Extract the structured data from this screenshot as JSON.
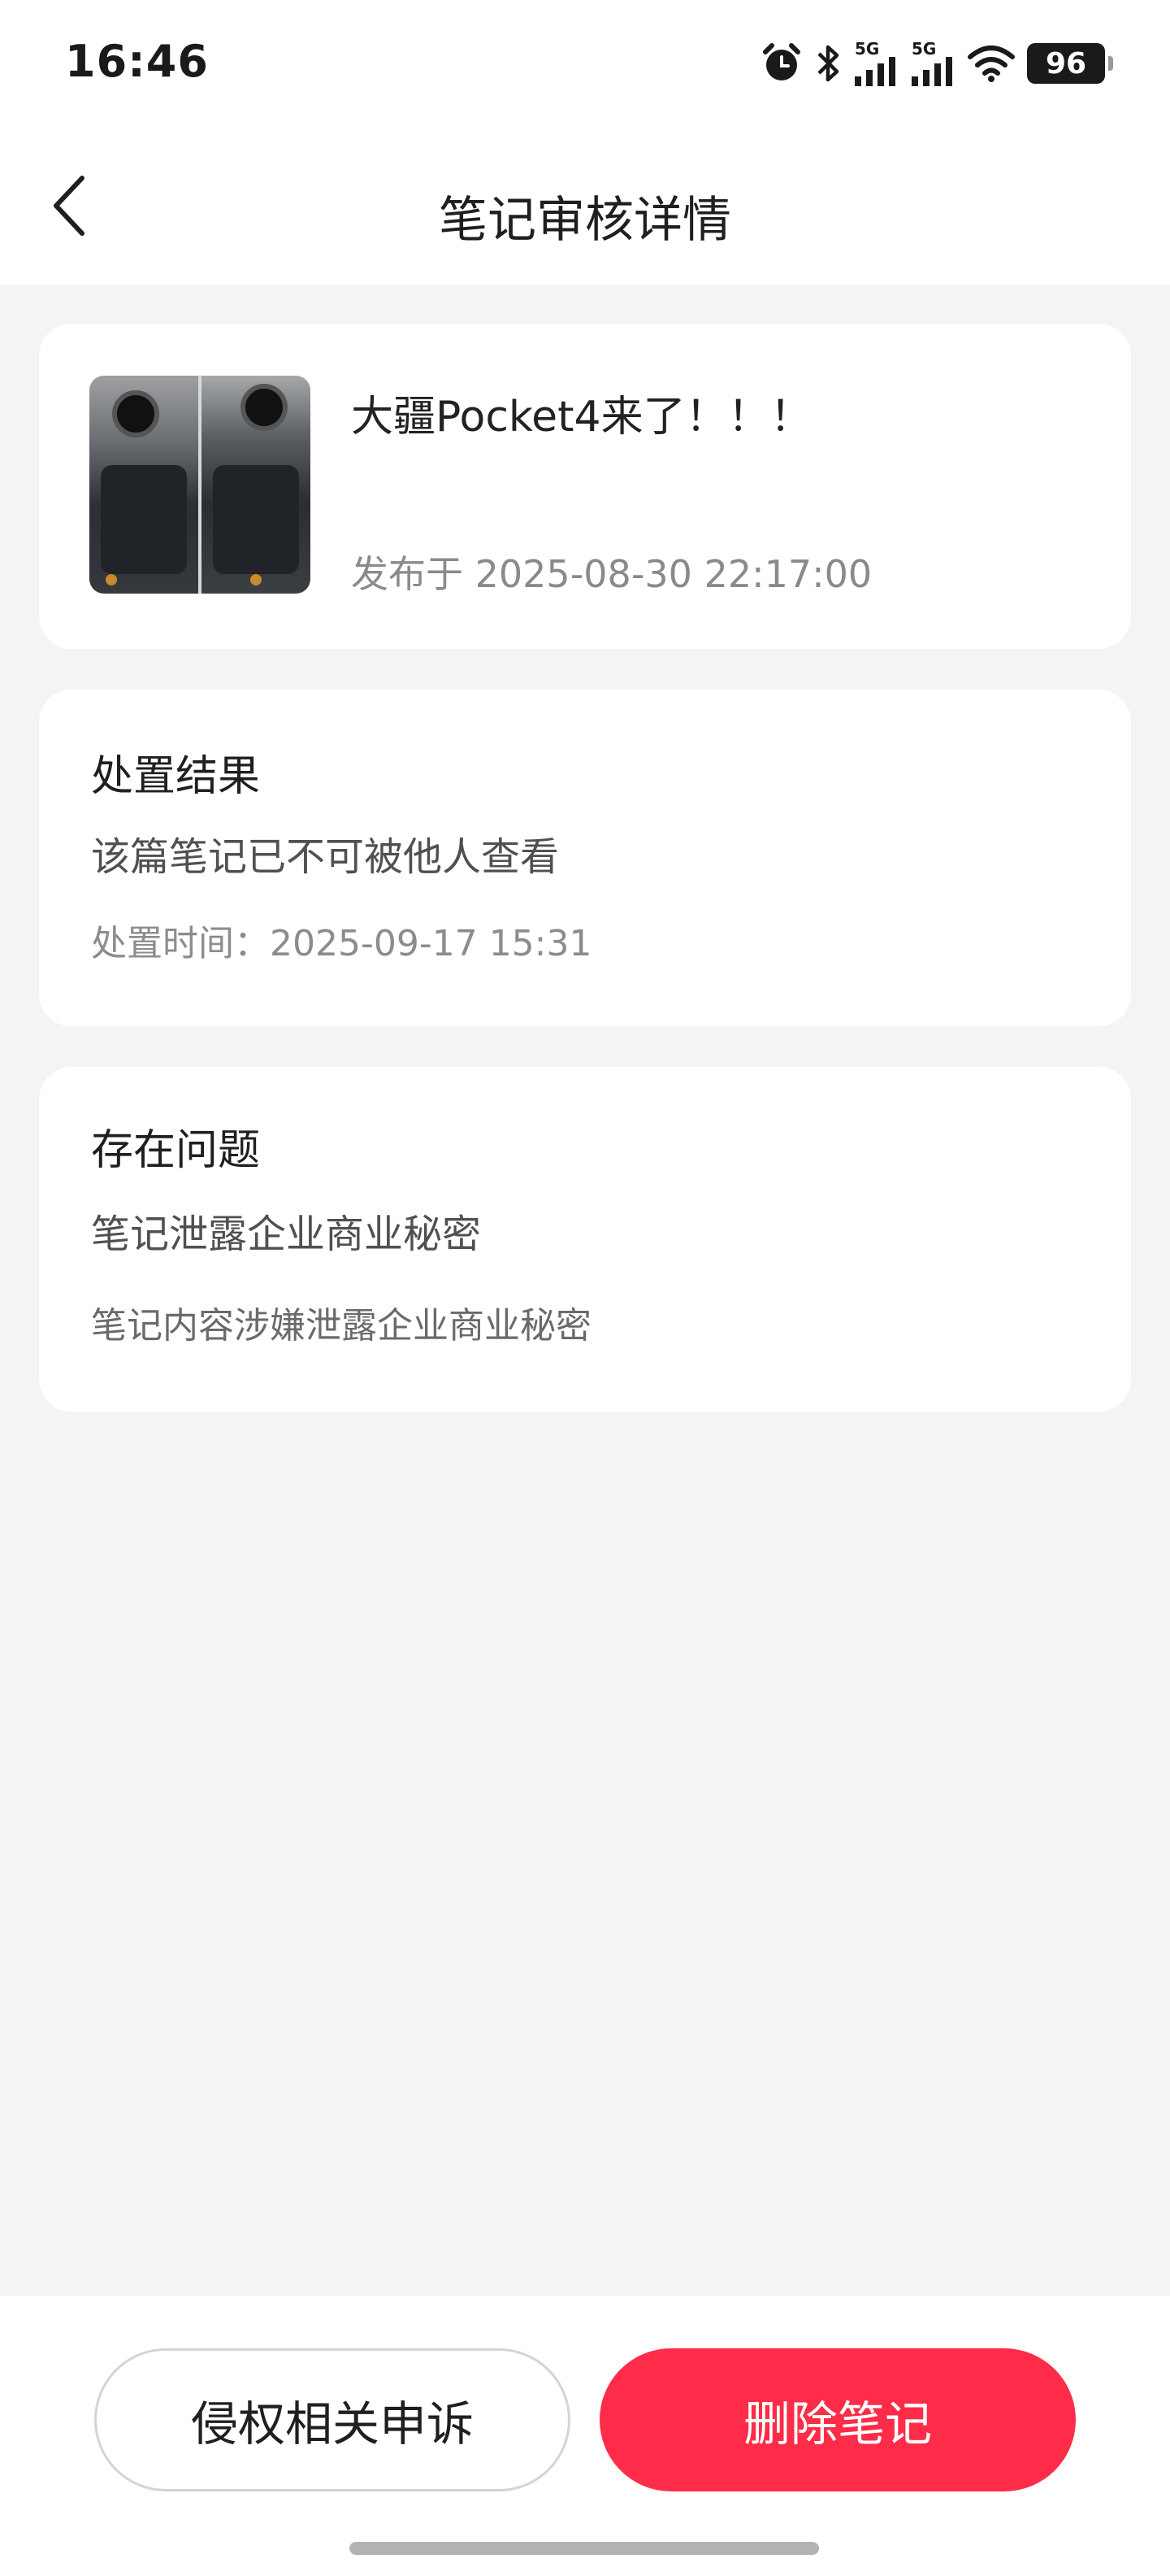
{
  "status_bar": {
    "time": "16:46",
    "icons": [
      "alarm-icon",
      "bluetooth-icon",
      "signal-icon",
      "signal-icon",
      "wifi-icon",
      "battery-icon"
    ],
    "network_1": "5G",
    "network_2": "5G",
    "battery": "96"
  },
  "nav": {
    "back_icon": "chevron-left-icon",
    "title": "笔记审核详情"
  },
  "note": {
    "title": "大疆Pocket4来了！！！",
    "published": "发布于 2025-08-30 22:17:00"
  },
  "result": {
    "heading": "处置结果",
    "status": "该篇笔记已不可被他人查看",
    "time": "处置时间：2025-09-17 15:31"
  },
  "issue": {
    "heading": "存在问题",
    "title": "笔记泄露企业商业秘密",
    "detail": "笔记内容涉嫌泄露企业商业秘密"
  },
  "actions": {
    "appeal_label": "侵权相关申诉",
    "delete_label": "删除笔记"
  },
  "colors": {
    "accent": "#fe2c48",
    "background": "#f4f4f4",
    "card": "#ffffff"
  }
}
